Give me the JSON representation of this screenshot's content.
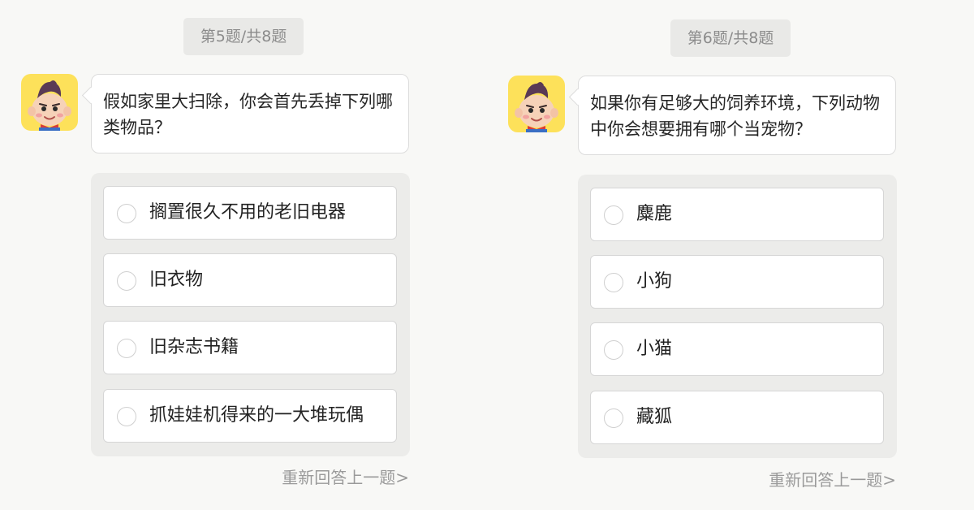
{
  "colors": {
    "background": "#f8f8f6",
    "avatar_bg": "#fde15a",
    "options_panel": "#ececea",
    "muted_text": "#9a9a9a"
  },
  "icons": [
    "boy-mascot-avatar-icon",
    "radio-empty-icon"
  ],
  "questions": [
    {
      "counter": "第5题/共8题",
      "prompt": "假如家里大扫除，你会首先丢掉下列哪类物品？",
      "options": [
        "搁置很久不用的老旧电器",
        "旧衣物",
        "旧杂志书籍",
        "抓娃娃机得来的一大堆玩偶"
      ],
      "redo": "重新回答上一题>"
    },
    {
      "counter": "第6题/共8题",
      "prompt": "如果你有足够大的饲养环境，下列动物中你会想要拥有哪个当宠物？",
      "options": [
        "麋鹿",
        "小狗",
        "小猫",
        "藏狐"
      ],
      "redo": "重新回答上一题>"
    }
  ]
}
